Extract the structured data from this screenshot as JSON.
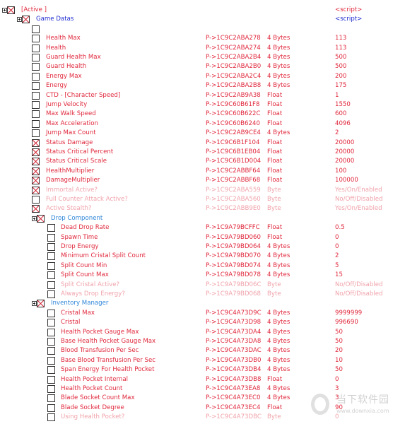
{
  "colors": {
    "enabled": "#e0283c",
    "disabled": "#f0a3ab",
    "group": "#1f2bd0",
    "subgroup": "#2f86d8"
  },
  "rows": [
    {
      "level": 0,
      "expand": true,
      "checked": true,
      "desc": "[Active ]",
      "value": "<script>",
      "style": "red"
    },
    {
      "level": 1,
      "expand": true,
      "checked": true,
      "desc": "Game Datas",
      "value": "<script>",
      "style": "blue"
    },
    {
      "level": 2,
      "checked": false,
      "desc": "",
      "style": "red"
    },
    {
      "level": 2,
      "checked": false,
      "desc": "Health Max",
      "address": "P->1C9C2ABA278",
      "type": "4 Bytes",
      "value": "113",
      "style": "red"
    },
    {
      "level": 2,
      "checked": false,
      "desc": "Health",
      "address": "P->1C9C2ABA274",
      "type": "4 Bytes",
      "value": "113",
      "style": "red"
    },
    {
      "level": 2,
      "checked": false,
      "desc": "Guard Health Max",
      "address": "P->1C9C2ABA2B4",
      "type": "4 Bytes",
      "value": "500",
      "style": "red"
    },
    {
      "level": 2,
      "checked": false,
      "desc": "Guard Health",
      "address": "P->1C9C2ABA2B0",
      "type": "4 Bytes",
      "value": "500",
      "style": "red"
    },
    {
      "level": 2,
      "checked": false,
      "desc": "Energy Max",
      "address": "P->1C9C2ABA2C4",
      "type": "4 Bytes",
      "value": "200",
      "style": "red"
    },
    {
      "level": 2,
      "checked": false,
      "desc": "Energy",
      "address": "P->1C9C2ABA2B8",
      "type": "4 Bytes",
      "value": "175",
      "style": "red"
    },
    {
      "level": 2,
      "checked": false,
      "desc": "CTD - [Character Speed]",
      "address": "P->1C9C2AB9A38",
      "type": "Float",
      "value": "1",
      "style": "red"
    },
    {
      "level": 2,
      "checked": false,
      "desc": "Jump Velocity",
      "address": "P->1C9C60B61F8",
      "type": "Float",
      "value": "1550",
      "style": "red"
    },
    {
      "level": 2,
      "checked": false,
      "desc": "Max Walk Speed",
      "address": "P->1C9C60B622C",
      "type": "Float",
      "value": "600",
      "style": "red"
    },
    {
      "level": 2,
      "checked": false,
      "desc": "Max Acceleration",
      "address": "P->1C9C60B6240",
      "type": "Float",
      "value": "4096",
      "style": "red"
    },
    {
      "level": 2,
      "checked": false,
      "desc": "Jump Max Count",
      "address": "P->1C9C2AB9CE4",
      "type": "4 Bytes",
      "value": "2",
      "style": "red"
    },
    {
      "level": 2,
      "checked": true,
      "desc": "Status Damage",
      "address": "P->1C9C6B1F104",
      "type": "Float",
      "value": "20000",
      "style": "red"
    },
    {
      "level": 2,
      "checked": true,
      "desc": "Status Critical Percent",
      "address": "P->1C9C6B1EB04",
      "type": "Float",
      "value": "20000",
      "style": "red"
    },
    {
      "level": 2,
      "checked": true,
      "desc": "Status Critical Scale",
      "address": "P->1C9C6B1D004",
      "type": "Float",
      "value": "20000",
      "style": "red"
    },
    {
      "level": 2,
      "checked": true,
      "desc": "HealthMultiplier",
      "address": "P->1C9C2ABBF64",
      "type": "Float",
      "value": "100",
      "style": "red"
    },
    {
      "level": 2,
      "checked": true,
      "desc": "DamageMultiplier",
      "address": "P->1C9C2ABBF68",
      "type": "Float",
      "value": "100000",
      "style": "red"
    },
    {
      "level": 2,
      "checked": true,
      "desc": "Immortal Active?",
      "address": "P->1C9C2ABA559",
      "type": "Byte",
      "value": "Yes/On/Enabled",
      "style": "dis"
    },
    {
      "level": 2,
      "checked": false,
      "desc": "Full Counter Attack Active?",
      "address": "P->1C9C2ABA560",
      "type": "Byte",
      "value": "No/Off/Disabled",
      "style": "dis"
    },
    {
      "level": 2,
      "checked": true,
      "desc": "Active Stealth?",
      "address": "P->1C9C2ABB9E0",
      "type": "Byte",
      "value": "Yes/On/Enabled",
      "style": "dis"
    },
    {
      "level": 2,
      "expand": true,
      "checked": true,
      "desc": "Drop Component",
      "style": "lblue"
    },
    {
      "level": 3,
      "checked": false,
      "desc": "Dead Drop Rate",
      "address": "P->1C9A79BCFFC",
      "type": "Float",
      "value": "0.5",
      "style": "red"
    },
    {
      "level": 3,
      "checked": false,
      "desc": "Spawn Time",
      "address": "P->1C9A79BD060",
      "type": "Float",
      "value": "0",
      "style": "red"
    },
    {
      "level": 3,
      "checked": false,
      "desc": "Drop Energy",
      "address": "P->1C9A79BD064",
      "type": "4 Bytes",
      "value": "0",
      "style": "red"
    },
    {
      "level": 3,
      "checked": false,
      "desc": "Minimum Cristal Split Count",
      "address": "P->1C9A79BD070",
      "type": "4 Bytes",
      "value": "2",
      "style": "red"
    },
    {
      "level": 3,
      "checked": false,
      "desc": "Split Count Min",
      "address": "P->1C9A79BD074",
      "type": "4 Bytes",
      "value": "5",
      "style": "red"
    },
    {
      "level": 3,
      "checked": false,
      "desc": "Split Count Max",
      "address": "P->1C9A79BD078",
      "type": "4 Bytes",
      "value": "15",
      "style": "red"
    },
    {
      "level": 3,
      "checked": false,
      "desc": "Split Cristal Active?",
      "address": "P->1C9A79BD06C",
      "type": "Byte",
      "value": "No/Off/Disabled",
      "style": "dis"
    },
    {
      "level": 3,
      "checked": false,
      "desc": "Always Drop Energy?",
      "address": "P->1C9A79BD068",
      "type": "Byte",
      "value": "No/Off/Disabled",
      "style": "dis"
    },
    {
      "level": 2,
      "expand": true,
      "checked": true,
      "desc": "Inventory Manager",
      "style": "lblue"
    },
    {
      "level": 3,
      "checked": false,
      "desc": "Cristal Max",
      "address": "P->1C9C4A73D9C",
      "type": "4 Bytes",
      "value": "9999999",
      "style": "red"
    },
    {
      "level": 3,
      "checked": false,
      "desc": "Cristal",
      "address": "P->1C9C4A73D98",
      "type": "4 Bytes",
      "value": "996690",
      "style": "red"
    },
    {
      "level": 3,
      "checked": false,
      "desc": "Health Pocket Gauge Max",
      "address": "P->1C9C4A73DA4",
      "type": "4 Bytes",
      "value": "50",
      "style": "red"
    },
    {
      "level": 3,
      "checked": false,
      "desc": "Base Health Pocket Gauge Max",
      "address": "P->1C9C4A73DA8",
      "type": "4 Bytes",
      "value": "50",
      "style": "red"
    },
    {
      "level": 3,
      "checked": false,
      "desc": "Blood Transfusion Per Sec",
      "address": "P->1C9C4A73DAC",
      "type": "4 Bytes",
      "value": "20",
      "style": "red"
    },
    {
      "level": 3,
      "checked": false,
      "desc": "Base Blood Transfusion Per Sec",
      "address": "P->1C9C4A73DB0",
      "type": "4 Bytes",
      "value": "10",
      "style": "red"
    },
    {
      "level": 3,
      "checked": false,
      "desc": "Span Energy For Health Pocket",
      "address": "P->1C9C4A73DB4",
      "type": "4 Bytes",
      "value": "50",
      "style": "red"
    },
    {
      "level": 3,
      "checked": false,
      "desc": "Health Pocket Internal",
      "address": "P->1C9C4A73DB8",
      "type": "Float",
      "value": "0",
      "style": "red"
    },
    {
      "level": 3,
      "checked": false,
      "desc": "Health Pocket Count",
      "address": "P->1C9C4A73EA8",
      "type": "4 Bytes",
      "value": "3",
      "style": "red"
    },
    {
      "level": 3,
      "checked": false,
      "desc": "Blade Socket Count Max",
      "address": "P->1C9C4A73EC0",
      "type": "4 Bytes",
      "value": "3",
      "style": "red"
    },
    {
      "level": 3,
      "checked": false,
      "desc": "Blade Socket Degree",
      "address": "P->1C9C4A73EC4",
      "type": "Float",
      "value": "90",
      "style": "red"
    },
    {
      "level": 3,
      "checked": false,
      "desc": "Using Health Pocket?",
      "address": "P->1C9C4A73DBC",
      "type": "Byte",
      "value": "0",
      "style": "dis"
    }
  ],
  "watermark": {
    "name": "当下软件园",
    "url": "www.downxia.com"
  }
}
